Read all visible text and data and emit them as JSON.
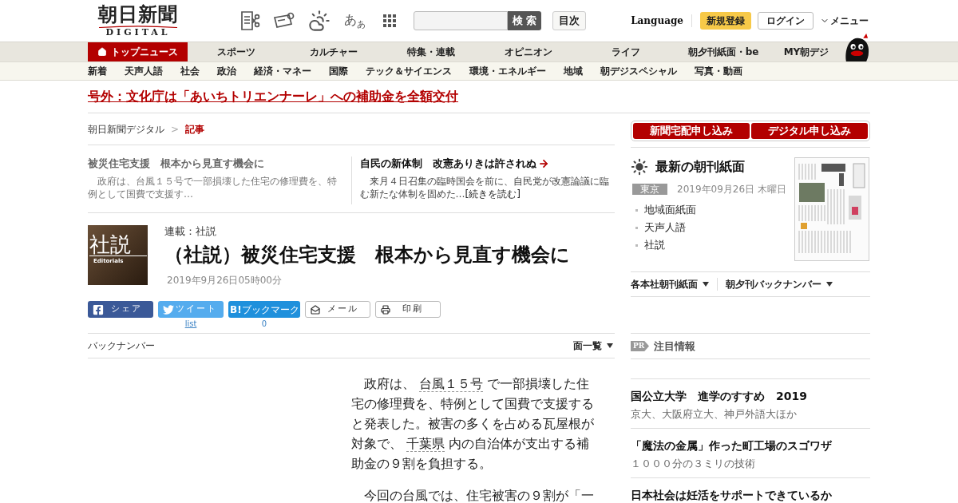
{
  "header": {
    "logo": {
      "title": "朝日新聞",
      "subtitle": "DIGITAL"
    },
    "text_size": {
      "large": "あ",
      "small": "あ"
    },
    "search": {
      "button": "検 索"
    },
    "index_button": "目次",
    "language": "Language",
    "signup": "新規登録",
    "login": "ログイン",
    "menu": "メニュー"
  },
  "main_nav": [
    {
      "label": "トップニュース",
      "kind": "home",
      "selected": true
    },
    {
      "label": "スポーツ",
      "kind": "section",
      "selected": false
    },
    {
      "label": "カルチャー",
      "kind": "section",
      "selected": false
    },
    {
      "label": "特集・連載",
      "kind": "section",
      "selected": false
    },
    {
      "label": "オピニオン",
      "kind": "section",
      "selected": false
    },
    {
      "label": "ライフ",
      "kind": "section",
      "selected": false
    },
    {
      "label": "朝夕刊紙面・be",
      "kind": "section",
      "selected": false
    },
    {
      "label": "MY朝デジ",
      "kind": "section",
      "selected": false
    }
  ],
  "sub_nav": [
    "新着",
    "天声人語",
    "社会",
    "政治",
    "経済・マネー",
    "国際",
    "テック＆サイエンス",
    "環境・エネルギー",
    "地域",
    "朝デジスペシャル",
    "写真・動画"
  ],
  "breaking_news": "号外：文化庁は「あいちトリエンナーレ」への補助金を全額交付",
  "breadcrumb": {
    "separator": ">",
    "items": [
      {
        "label": "朝日新聞デジタル",
        "current": false
      },
      {
        "label": "記事",
        "current": true
      }
    ]
  },
  "related": [
    {
      "title": "被災住宅支援　根本から見直す機会に",
      "summary": "政府は、台風１５号で一部損壊した住宅の修理費を、特例として国費で支援す…",
      "current": true
    },
    {
      "title": "自民の新体制　改憲ありきは許されぬ",
      "summary": "来月４日召集の臨時国会を前に、自民党が改憲論議に臨む新たな体制を固めた…",
      "more": "[続きを読む]",
      "current": false
    }
  ],
  "article": {
    "badge": {
      "title": "社説",
      "subtitle": "Editorials"
    },
    "series": "連載：社説",
    "title": "（社説）被災住宅支援　根本から見直す機会に",
    "date": "2019年9月26日05時00分",
    "share": [
      {
        "kind": "facebook",
        "label": "シェア"
      },
      {
        "kind": "twitter",
        "label": "ツイート",
        "count": "list"
      },
      {
        "kind": "hatena",
        "mark": "B!",
        "label": "ブックマーク",
        "count": "0"
      },
      {
        "kind": "mail",
        "label": "メール"
      },
      {
        "kind": "print",
        "label": "印刷"
      }
    ],
    "back_number": "バックナンバー",
    "page_list": "面一覧",
    "body": [
      [
        {
          "kind": "text",
          "text": "政府は、"
        },
        {
          "kind": "link",
          "text": "台風１５号"
        },
        {
          "kind": "text",
          "text": "で一部損壊した住宅の修理費を、特例として国費で支援すると発表した。被害の多くを占める瓦屋根が対象で、"
        },
        {
          "kind": "link",
          "text": "千葉県"
        },
        {
          "kind": "text",
          "text": "内の自治体が支出する補助金の９割を負担する。"
        }
      ],
      [
        {
          "kind": "text",
          "text": "今回の台風では、住宅被害の９割が「一"
        }
      ]
    ]
  },
  "sidebar": {
    "apply_buttons": [
      "新聞宅配申し込み",
      "デジタル申し込み"
    ],
    "morning_paper": {
      "title": "最新の朝刊紙面",
      "region": "東京",
      "date": "2019年09月26日 木曜日",
      "links": [
        "地域面紙面",
        "天声人語",
        "社説"
      ]
    },
    "dropdowns": [
      "各本社朝刊紙面",
      "朝夕刊バックナンバー"
    ],
    "pr": {
      "tag": "PR",
      "title": "注目情報"
    },
    "promos": [
      {
        "title": "国公立大学　進学のすすめ　2019",
        "subtitle": "京大、大阪府立大、神戸外語大ほか"
      },
      {
        "title": "「魔法の金属」作った町工場のスゴワザ",
        "subtitle": "１０００分の３ミリの技術"
      },
      {
        "title": "日本社会は妊活をサポートできているか"
      }
    ]
  }
}
